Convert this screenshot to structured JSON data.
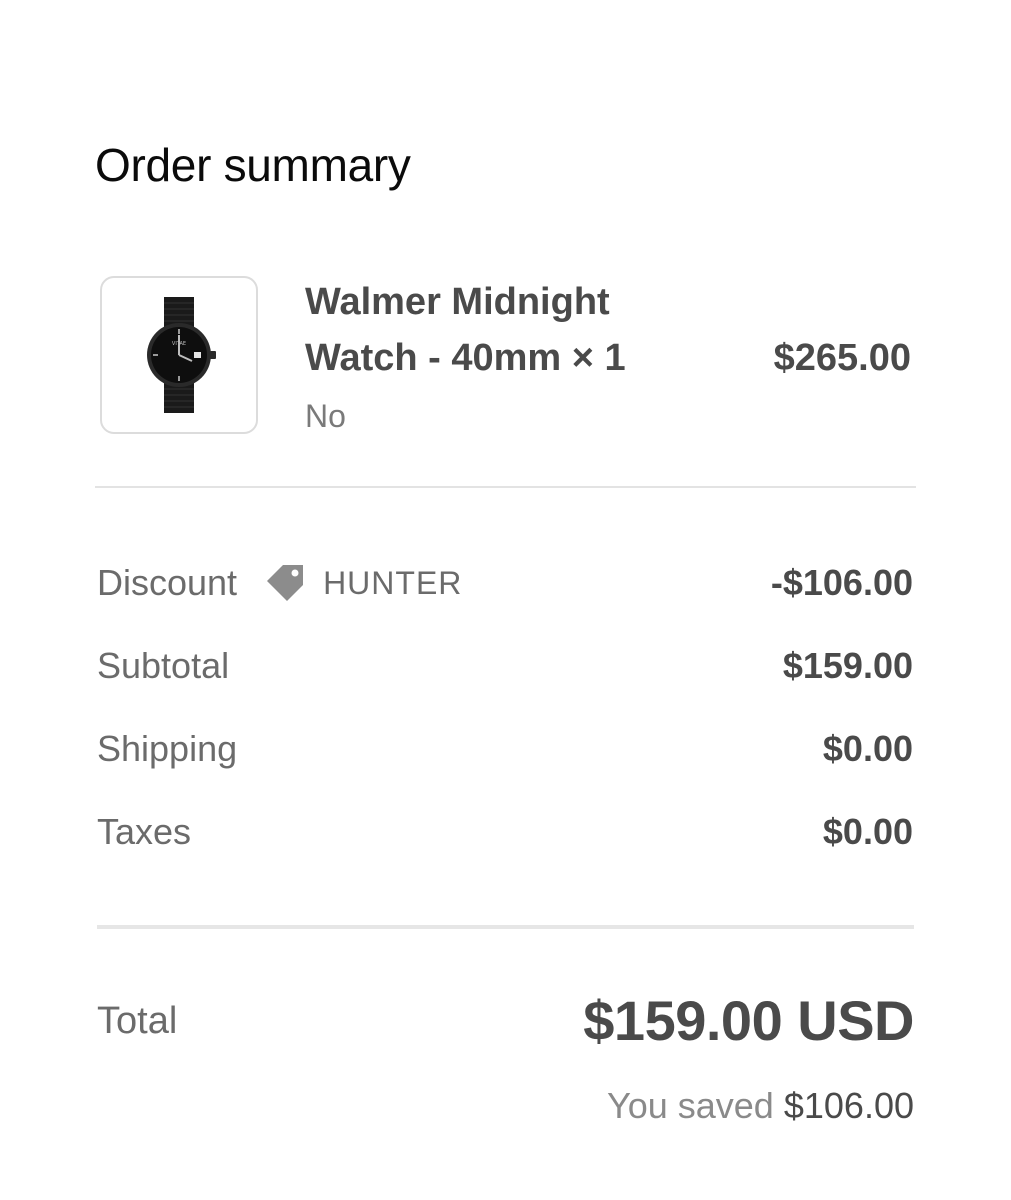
{
  "order_summary": {
    "title": "Order summary",
    "item": {
      "name_line1": "Walmer Midnight",
      "name_line2": "Watch - 40mm × 1",
      "variant": "No",
      "price": "$265.00",
      "image": "black-watch-product-image"
    },
    "lines": [
      {
        "label": "Discount",
        "code": "HUNTER",
        "code_icon": "tag-icon",
        "value": "-$106.00"
      },
      {
        "label": "Subtotal",
        "value": "$159.00"
      },
      {
        "label": "Shipping",
        "value": "$0.00"
      },
      {
        "label": "Taxes",
        "value": "$0.00"
      }
    ],
    "total": {
      "label": "Total",
      "value": "$159.00 USD",
      "saved_prefix": "You saved",
      "saved_amount": "$106.00"
    }
  },
  "colors": {
    "text_dark": "#4a4a4a",
    "text_muted": "#6b6b6b",
    "divider": "#e3e3e3",
    "tag_gray": "#8c8c8c"
  }
}
